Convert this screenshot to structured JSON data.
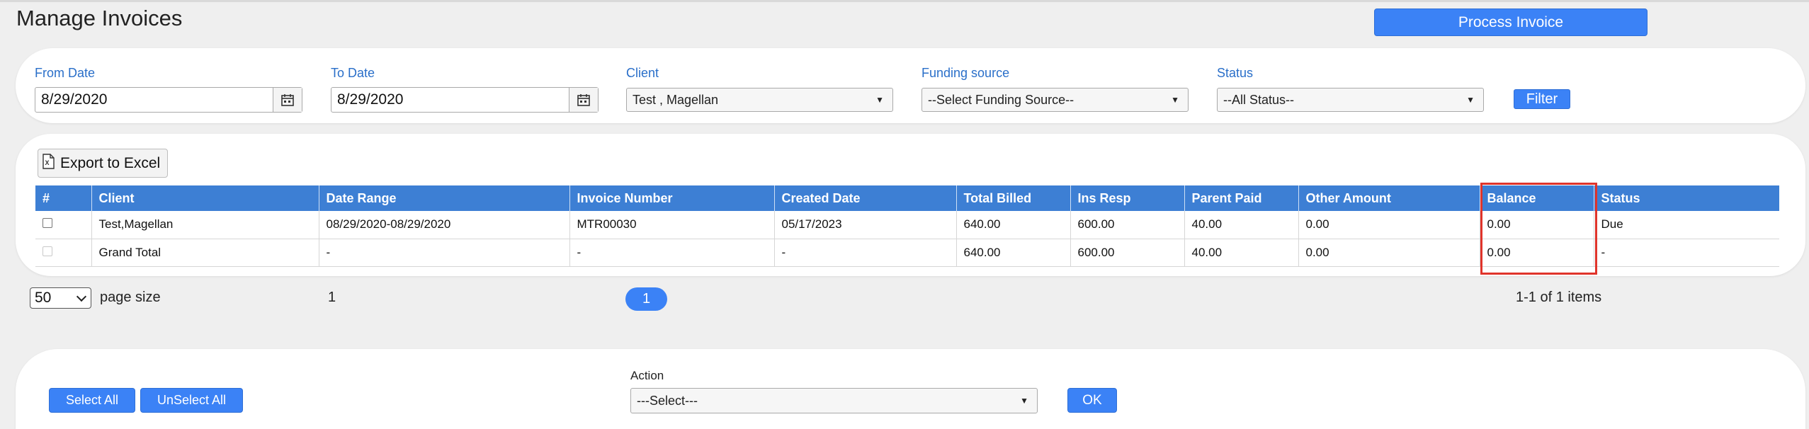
{
  "page": {
    "title": "Manage Invoices",
    "process_invoice_label": "Process Invoice"
  },
  "filters": {
    "from_date": {
      "label": "From Date",
      "value": "8/29/2020",
      "icon": "calendar-icon"
    },
    "to_date": {
      "label": "To Date",
      "value": "8/29/2020",
      "icon": "calendar-icon"
    },
    "client": {
      "label": "Client",
      "selected": "Test , Magellan"
    },
    "funding_source": {
      "label": "Funding source",
      "selected": "--Select Funding Source--"
    },
    "status": {
      "label": "Status",
      "selected": "--All Status--"
    },
    "filter_label": "Filter"
  },
  "grid": {
    "export_label": "Export to Excel",
    "export_icon": "excel-icon",
    "columns": [
      "#",
      "Client",
      "Date Range",
      "Invoice Number",
      "Created Date",
      "Total Billed",
      "Ins Resp",
      "Parent Paid",
      "Other Amount",
      "Balance",
      "Status"
    ],
    "rows": [
      {
        "client": "Test,Magellan",
        "date_range": "08/29/2020-08/29/2020",
        "invoice_number": "MTR00030",
        "created_date": "05/17/2023",
        "total_billed": "640.00",
        "ins_resp": "600.00",
        "parent_paid": "40.00",
        "other_amount": "0.00",
        "balance": "0.00",
        "status": "Due"
      },
      {
        "client": "Grand Total",
        "date_range": "-",
        "invoice_number": "-",
        "created_date": "-",
        "total_billed": "640.00",
        "ins_resp": "600.00",
        "parent_paid": "40.00",
        "other_amount": "0.00",
        "balance": "0.00",
        "status": "-"
      }
    ],
    "highlight_color": "#e0342b"
  },
  "pager": {
    "page_size": "50",
    "page_size_label": "page size",
    "page_number_text": "1",
    "current_page": "1",
    "items_info": "1-1 of 1 items"
  },
  "actions": {
    "select_all_label": "Select All",
    "unselect_all_label": "UnSelect All",
    "action_label": "Action",
    "action_selected": "---Select---",
    "ok_label": "OK"
  },
  "colors": {
    "accent": "#3b82f6",
    "header_bg": "#3d7fd4",
    "label_blue": "#2a6fc9"
  }
}
